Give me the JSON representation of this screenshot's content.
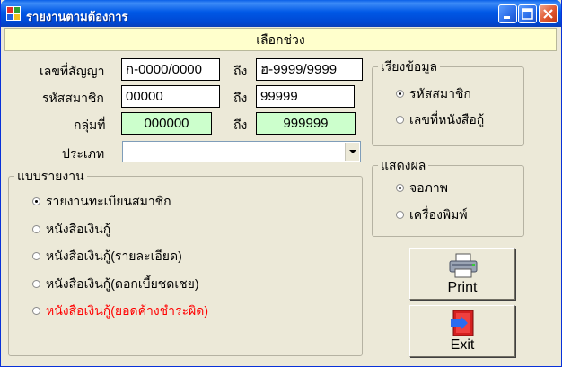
{
  "window": {
    "title": "รายงานตามต้องการ"
  },
  "banner": {
    "text": "เลือกช่วง"
  },
  "filters": {
    "to_label": "ถึง",
    "contract": {
      "label": "เลขที่สัญญา",
      "from": "ก-0000/0000",
      "to": "ฮ-9999/9999"
    },
    "member": {
      "label": "รหัสสมาชิก",
      "from": "00000",
      "to": "99999"
    },
    "group": {
      "label": "กลุ่มที่",
      "from": "000000",
      "to": "999999"
    },
    "type": {
      "label": "ประเภท",
      "value": ""
    }
  },
  "sort": {
    "title": "เรียงข้อมูล",
    "options": [
      {
        "label": "รหัสสมาชิก",
        "selected": true
      },
      {
        "label": "เลขที่หนังสือกู้",
        "selected": false
      }
    ]
  },
  "display": {
    "title": "แสดงผล",
    "options": [
      {
        "label": "จอภาพ",
        "selected": true
      },
      {
        "label": "เครื่องพิมพ์",
        "selected": false
      }
    ]
  },
  "report": {
    "title": "แบบรายงาน",
    "options": [
      {
        "label": "รายงานทะเบียนสมาชิก",
        "selected": true
      },
      {
        "label": "หนังสือเงินกู้",
        "selected": false
      },
      {
        "label": "หนังสือเงินกู้(รายละเอียด)",
        "selected": false
      },
      {
        "label": "หนังสือเงินกู้(ดอกเบี้ยชดเชย)",
        "selected": false
      },
      {
        "label": "หนังสือเงินกู้(ยอดค้างชำระผิด)",
        "selected": false,
        "color": "#ff0000"
      }
    ]
  },
  "buttons": {
    "print": {
      "label": "Print",
      "icon": "printer-icon"
    },
    "exit": {
      "label": "Exit",
      "icon": "exit-door-icon"
    }
  },
  "colors": {
    "titlebar": "#0058e6",
    "banner": "#ffffcc",
    "range_green": "#ccffcc",
    "alert_red": "#ff0000"
  }
}
